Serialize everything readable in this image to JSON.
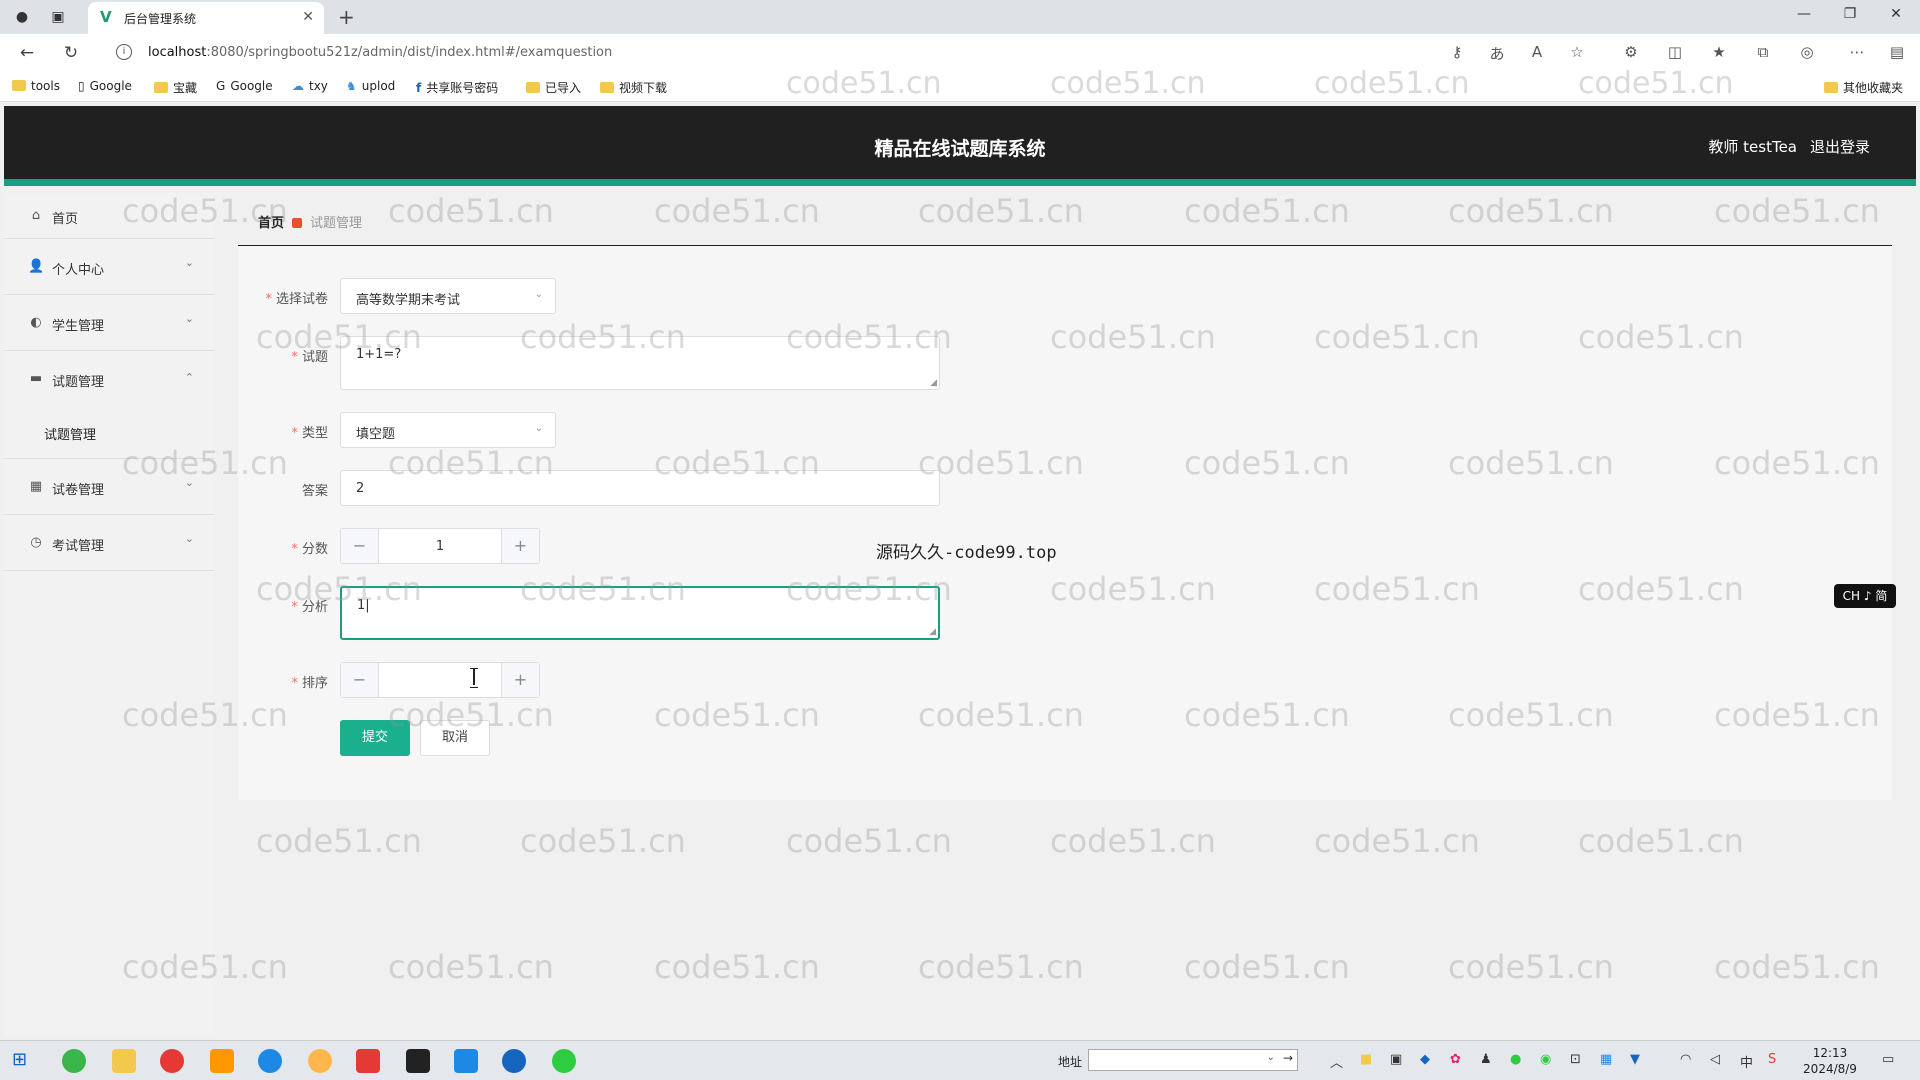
{
  "browser": {
    "tab_title": "后台管理系统",
    "url_host": "localhost",
    "url_rest": ":8080/springbootu521z/admin/dist/index.html#/examquestion",
    "bookmarks": [
      "tools",
      "Google",
      "宝藏",
      "Google",
      "txy",
      "uplod",
      "共享账号密码",
      "已导入",
      "视频下载",
      "其他收藏夹"
    ]
  },
  "header": {
    "title": "精品在线试题库系统",
    "user": "教师 testTea",
    "logout": "退出登录"
  },
  "sidebar": {
    "items": [
      {
        "label": "首页",
        "icon": "home-icon"
      },
      {
        "label": "个人中心",
        "icon": "user-icon"
      },
      {
        "label": "学生管理",
        "icon": "student-icon"
      },
      {
        "label": "试题管理",
        "icon": "briefcase-icon"
      },
      {
        "label": "试卷管理",
        "icon": "grid-icon"
      },
      {
        "label": "考试管理",
        "icon": "clock-icon"
      }
    ],
    "submenu": [
      "试题管理"
    ]
  },
  "breadcrumb": {
    "home": "首页",
    "current": "试题管理"
  },
  "form": {
    "paper_label": "选择试卷",
    "paper_value": "高等数学期末考试",
    "question_label": "试题",
    "question_value": "1+1=?",
    "type_label": "类型",
    "type_value": "填空题",
    "answer_label": "答案",
    "answer_value": "2",
    "score_label": "分数",
    "score_value": "1",
    "analysis_label": "分析",
    "analysis_value": "1|",
    "order_label": "排序",
    "order_value": "",
    "submit": "提交",
    "cancel": "取消"
  },
  "overlay": {
    "source_text": "源码久久-code99.top",
    "ime": "CH ♪ 简"
  },
  "watermark": "code51.cn",
  "taskbar": {
    "address_label": "地址",
    "time": "12:13",
    "date": "2024/8/9"
  },
  "colors": {
    "accent": "#1a9e82",
    "header_bg": "#202020",
    "submit_bg": "#1ab08d"
  }
}
